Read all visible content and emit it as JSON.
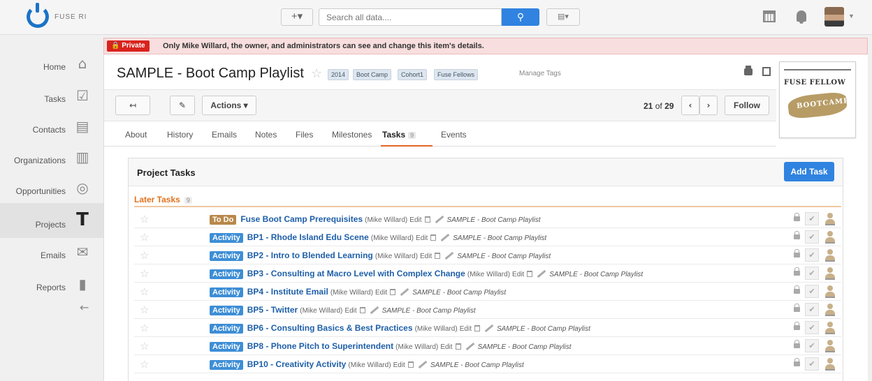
{
  "app": {
    "brand": "FUSE RI"
  },
  "topbar": {
    "quick_add_label": "+▾",
    "search_placeholder": "Search all data....",
    "search_button_icon": "search-icon",
    "view_toggle_label": "▤▾"
  },
  "sidebar": {
    "items": [
      {
        "label": "Home",
        "icon": "home-icon",
        "glyph": "⌂"
      },
      {
        "label": "Tasks",
        "icon": "checkbox-icon",
        "glyph": "☑"
      },
      {
        "label": "Contacts",
        "icon": "contact-card-icon",
        "glyph": "▤"
      },
      {
        "label": "Organizations",
        "icon": "building-icon",
        "glyph": "▥"
      },
      {
        "label": "Opportunities",
        "icon": "target-icon",
        "glyph": "◎"
      },
      {
        "label": "Projects",
        "icon": "hammer-icon",
        "glyph": "T"
      },
      {
        "label": "Emails",
        "icon": "envelope-icon",
        "glyph": "✉"
      },
      {
        "label": "Reports",
        "icon": "bar-chart-icon",
        "glyph": "▮"
      }
    ],
    "active_item": "Projects",
    "collapse_glyph": "←"
  },
  "banner": {
    "badge": "🔒 Private",
    "text": "Only Mike Willard, the owner, and administrators can see and change this item's details."
  },
  "record": {
    "title": "SAMPLE - Boot Camp Playlist",
    "star_glyph": "☆",
    "tags": [
      "2014",
      "Boot Camp",
      "Cohort1",
      "Fuse Fellows"
    ],
    "manage_tags": "Manage Tags",
    "logo": {
      "title": "FUSE FELLOW",
      "stamp": "BOOTCAMP"
    }
  },
  "toolbar": {
    "back_glyph": "↤",
    "edit_glyph": "✎",
    "actions_label": "Actions ▾",
    "position": "21",
    "of_label": "of",
    "total": "29",
    "prev_glyph": "‹",
    "next_glyph": "›",
    "follow_label": "Follow"
  },
  "tabs": [
    {
      "label": "About"
    },
    {
      "label": "History"
    },
    {
      "label": "Emails"
    },
    {
      "label": "Notes"
    },
    {
      "label": "Files"
    },
    {
      "label": "Milestones"
    },
    {
      "label": "Tasks",
      "count": "9",
      "active": true
    },
    {
      "label": "Events"
    }
  ],
  "tasks_panel": {
    "title": "Project Tasks",
    "add_button": "Add Task",
    "group_label": "Later Tasks",
    "group_count": "9",
    "edit_label": "Edit",
    "tasks": [
      {
        "type": "To Do",
        "name": "Fuse Boot Camp Prerequisites",
        "owner": "(Mike Willard)",
        "project": "SAMPLE - Boot Camp Playlist"
      },
      {
        "type": "Activity",
        "name": "BP1 - Rhode Island Edu Scene",
        "owner": "(Mike Willard)",
        "project": "SAMPLE - Boot Camp Playlist"
      },
      {
        "type": "Activity",
        "name": "BP2 - Intro to Blended Learning",
        "owner": "(Mike Willard)",
        "project": "SAMPLE - Boot Camp Playlist"
      },
      {
        "type": "Activity",
        "name": "BP3 - Consulting at Macro Level with Complex Change",
        "owner": "(Mike Willard)",
        "project": "SAMPLE - Boot Camp Playlist"
      },
      {
        "type": "Activity",
        "name": "BP4 - Institute Email",
        "owner": "(Mike Willard)",
        "project": "SAMPLE - Boot Camp Playlist"
      },
      {
        "type": "Activity",
        "name": "BP5 - Twitter",
        "owner": "(Mike Willard)",
        "project": "SAMPLE - Boot Camp Playlist"
      },
      {
        "type": "Activity",
        "name": "BP6 - Consulting Basics & Best Practices",
        "owner": "(Mike Willard)",
        "project": "SAMPLE - Boot Camp Playlist"
      },
      {
        "type": "Activity",
        "name": "BP8 - Phone Pitch to Superintendent",
        "owner": "(Mike Willard)",
        "project": "SAMPLE - Boot Camp Playlist"
      },
      {
        "type": "Activity",
        "name": "BP10 - Creativity Activity",
        "owner": "(Mike Willard)",
        "project": "SAMPLE - Boot Camp Playlist"
      }
    ]
  },
  "colors": {
    "accent": "#3083e0",
    "private_red": "#d9231d",
    "later_tasks_orange": "#e2711d",
    "todo_badge": "#b8884a",
    "activity_badge": "#3d8ed6",
    "task_link": "#1e5fa8"
  }
}
